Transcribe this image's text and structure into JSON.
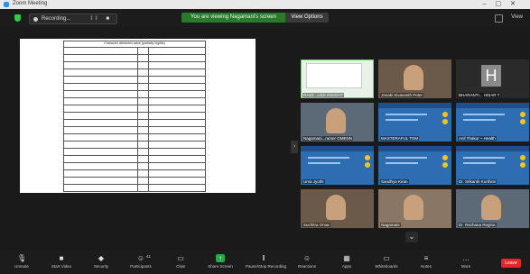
{
  "window": {
    "title": "Zoom Meeting"
  },
  "topbar": {
    "recording_label": "Recording...",
    "recording_controls": "II ■",
    "screen_banner": "You are viewing Nagamani's screen",
    "view_options": "View Options",
    "view_label": "View"
  },
  "document": {
    "header": "Character Attributes table (partially legible)",
    "rows": [
      [
        "",
        "",
        ""
      ],
      [
        "",
        "",
        ""
      ],
      [
        "",
        "",
        ""
      ],
      [
        "",
        "",
        ""
      ],
      [
        "",
        "",
        ""
      ],
      [
        "",
        "",
        ""
      ],
      [
        "",
        "",
        ""
      ],
      [
        "",
        "",
        ""
      ],
      [
        "",
        "",
        ""
      ],
      [
        "",
        "",
        ""
      ],
      [
        "",
        "",
        ""
      ],
      [
        "",
        "",
        ""
      ],
      [
        "",
        "",
        ""
      ],
      [
        "",
        "",
        ""
      ],
      [
        "",
        "",
        ""
      ],
      [
        "",
        "",
        ""
      ],
      [
        "",
        "",
        ""
      ],
      [
        "",
        "",
        ""
      ],
      [
        "",
        "",
        ""
      ],
      [
        "",
        "",
        ""
      ]
    ]
  },
  "participants": [
    {
      "name": "RAZZ...USS INSIGHT",
      "type": "screen"
    },
    {
      "name": "Janaki Sivavanth Peter",
      "type": "person"
    },
    {
      "name": "BHARANTI... HISAR T",
      "type": "avatar",
      "initial": "H"
    },
    {
      "name": "Nagamani...ramer GMENN",
      "type": "person"
    },
    {
      "name": "MASTERAFUL TOM",
      "type": "slide"
    },
    {
      "name": "Anil Thakur ~ Health",
      "type": "slide"
    },
    {
      "name": "Uma Jyothi",
      "type": "slide"
    },
    {
      "name": "Sandhya Kiran",
      "type": "slide"
    },
    {
      "name": "Dr. Srikanth Kurthimi",
      "type": "slide"
    },
    {
      "name": "Suchitra Omar",
      "type": "person"
    },
    {
      "name": "Nagamani",
      "type": "person"
    },
    {
      "name": "Dr. Rachana Regina",
      "type": "person"
    }
  ],
  "toolbar": {
    "items": [
      {
        "label": "Unmute",
        "icon": "microphone-icon"
      },
      {
        "label": "Start Video",
        "icon": "video-icon"
      },
      {
        "label": "Security",
        "icon": "shield-icon"
      },
      {
        "label": "Participants",
        "icon": "participants-icon",
        "count": "41"
      },
      {
        "label": "Chat",
        "icon": "chat-icon"
      },
      {
        "label": "Share Screen",
        "icon": "share-screen-icon"
      },
      {
        "label": "Pause/Stop Recording",
        "icon": "pause-icon"
      },
      {
        "label": "Reactions",
        "icon": "reaction-icon"
      },
      {
        "label": "Apps",
        "icon": "apps-icon"
      },
      {
        "label": "Whiteboards",
        "icon": "whiteboard-icon"
      },
      {
        "label": "Notes",
        "icon": "notes-icon"
      },
      {
        "label": "More",
        "icon": "more-icon"
      }
    ],
    "leave_label": "Leave"
  },
  "colors": {
    "accent_green": "#28a745",
    "banner_green": "#2b7a2b",
    "leave_red": "#e02828",
    "slide_blue": "#2f6db3"
  }
}
